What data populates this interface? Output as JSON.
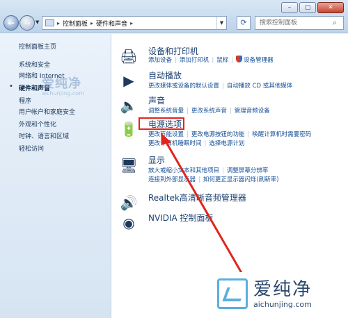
{
  "window": {
    "buttons": [
      "–",
      "▢",
      "✕"
    ]
  },
  "address": {
    "crumbs": [
      "控制面板",
      "硬件和声音"
    ],
    "search_placeholder": "搜索控制面板"
  },
  "sidebar": {
    "items": [
      {
        "label": "控制面板主页"
      },
      {
        "label": "系统和安全"
      },
      {
        "label": "网络和 Internet"
      },
      {
        "label": "硬件和声音",
        "current": true
      },
      {
        "label": "程序"
      },
      {
        "label": "用户帐户和家庭安全"
      },
      {
        "label": "外观和个性化"
      },
      {
        "label": "时钟、语言和区域"
      },
      {
        "label": "轻松访问"
      }
    ],
    "watermark": {
      "title": "爱纯净",
      "url": "aichunjing.com"
    }
  },
  "categories": [
    {
      "title": "设备和打印机",
      "icon": "printer-icon",
      "links": [
        [
          "添加设备",
          "添加打印机",
          "鼠标",
          "设备管理器"
        ]
      ]
    },
    {
      "title": "自动播放",
      "icon": "autoplay-icon",
      "links": [
        [
          "更改媒体或设备的默认设置",
          "自动播放 CD 或其他媒体"
        ]
      ]
    },
    {
      "title": "声音",
      "icon": "speaker-icon",
      "links": [
        [
          "调整系统音量",
          "更改系统声音",
          "管理音频设备"
        ]
      ]
    },
    {
      "title": "电源选项",
      "icon": "power-icon",
      "links": [
        [
          "更改节能设置",
          "更改电源按钮的功能",
          "唤醒计算机时需要密码"
        ],
        [
          "更改计算机睡眠时间",
          "选择电源计划"
        ]
      ]
    },
    {
      "title": "显示",
      "icon": "display-icon",
      "links": [
        [
          "放大或缩小文本和其他项目",
          "调整屏幕分辨率"
        ],
        [
          "连接到外部显示器",
          "如何更正显示器闪烁(刷新率)"
        ]
      ]
    },
    {
      "title": "Realtek高清晰音频管理器",
      "icon": "realtek-icon",
      "links": []
    },
    {
      "title": "NVIDIA 控制面板",
      "icon": "nvidia-icon",
      "links": []
    }
  ],
  "watermark": {
    "title": "爱纯净",
    "url": "aichunjing.com"
  },
  "colors": {
    "accent": "#e2241c",
    "link": "#154f97",
    "title": "#1a3f70"
  }
}
